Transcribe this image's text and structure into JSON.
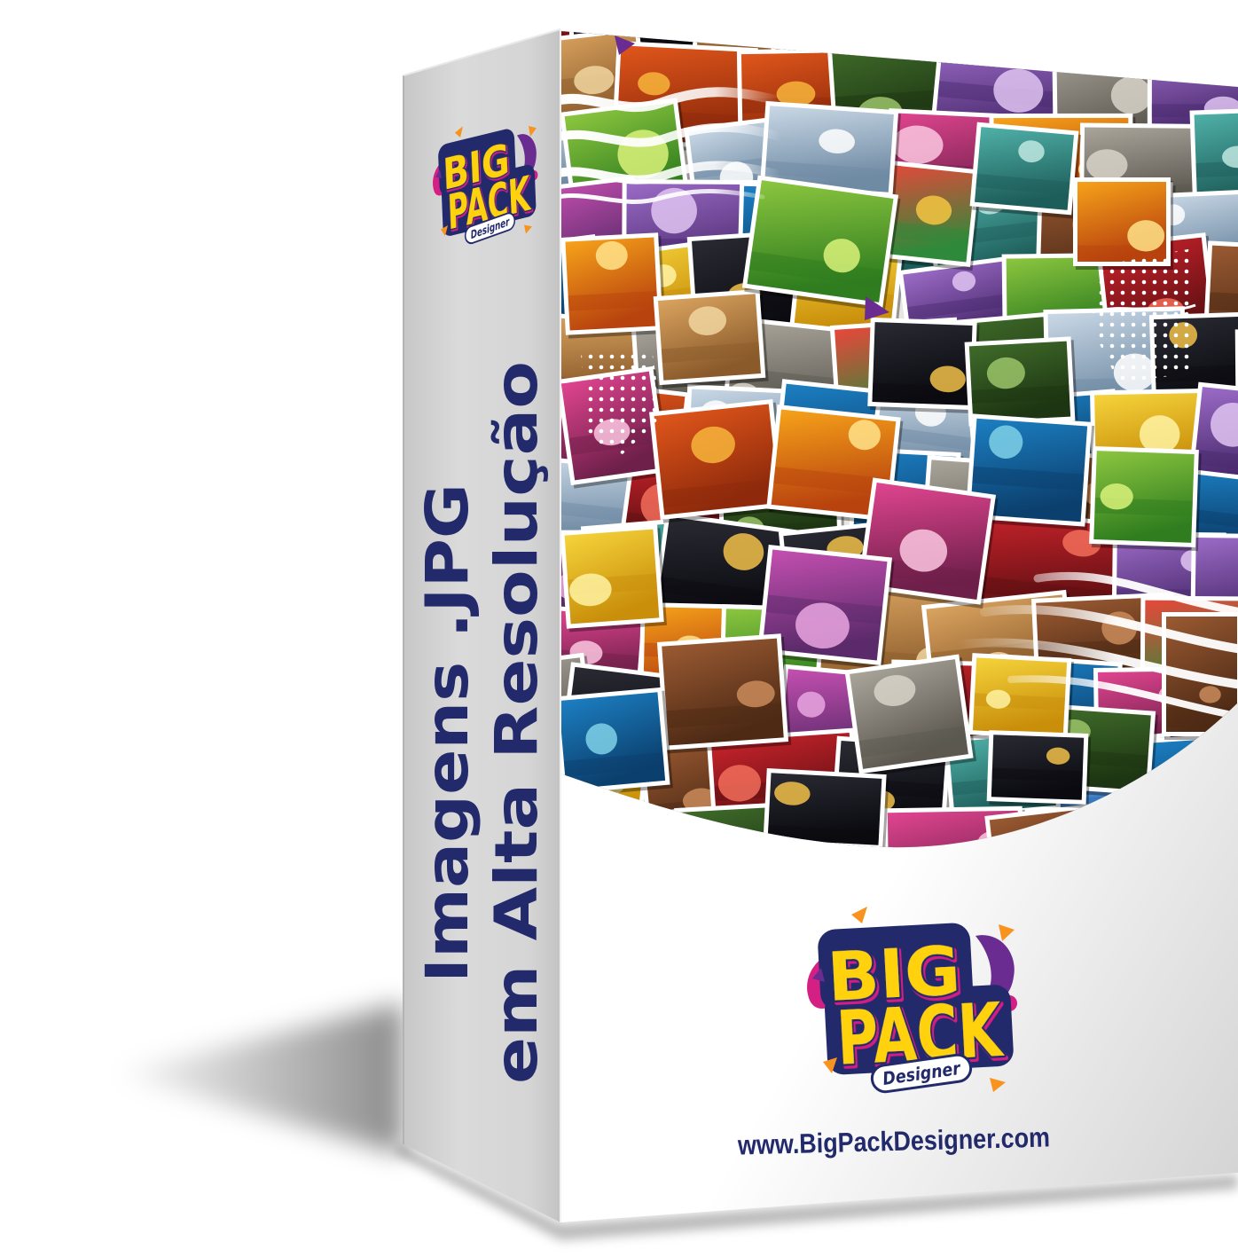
{
  "logo": {
    "big": "BIG",
    "pack": "PACK",
    "tagline": "Designer"
  },
  "spine": {
    "title_line1": "Imagens .JPG",
    "title_line2": "em Alta Resolução"
  },
  "front": {
    "website": "www.BigPackDesigner.com"
  },
  "colors": {
    "navy": "#232a6b",
    "logo_yellow": "#ffd20a",
    "logo_magenta": "#d41f84",
    "logo_purple": "#6a2c91",
    "logo_orange": "#f7931e",
    "white": "#ffffff"
  },
  "collage": {
    "palette": [
      [
        "#f6a21a",
        "#b8430e",
        "#ffe38a"
      ],
      [
        "#8cc63f",
        "#2f7d1f",
        "#d9f27a"
      ],
      [
        "#9b6bc6",
        "#4a2a6e",
        "#e0c4f2"
      ],
      [
        "#7fb8e8",
        "#2c6cb4",
        "#ffffff"
      ],
      [
        "#e0561b",
        "#8e2a0b",
        "#f7b53b"
      ],
      [
        "#e0458f",
        "#6e1f4a",
        "#fbc7e0"
      ],
      [
        "#d9a35f",
        "#8a5a2b",
        "#f1d6a0"
      ],
      [
        "#3f6b2a",
        "#1d3512",
        "#9bc46a"
      ],
      [
        "#1c7fc2",
        "#0b3f6d",
        "#7fd1e8"
      ],
      [
        "#a9a59b",
        "#5c5850",
        "#d8d4c9"
      ],
      [
        "#2a2a33",
        "#0a0a10",
        "#f2c14a"
      ],
      [
        "#f5d33b",
        "#c98e0a",
        "#fff3a3"
      ],
      [
        "#c8232b",
        "#5e0f12",
        "#f26d5b"
      ],
      [
        "#9a5a32",
        "#4e2a15",
        "#c98b5a"
      ],
      [
        "#c9d8e6",
        "#6f8aa3",
        "#ffffff"
      ],
      [
        "#4fb0a8",
        "#1e5e5a",
        "#bfe8e0"
      ],
      [
        "#c44fb0",
        "#5a2a6a",
        "#e9a6e0"
      ],
      [
        "#e8473a",
        "#2e8a3a",
        "#f4c542"
      ]
    ]
  }
}
